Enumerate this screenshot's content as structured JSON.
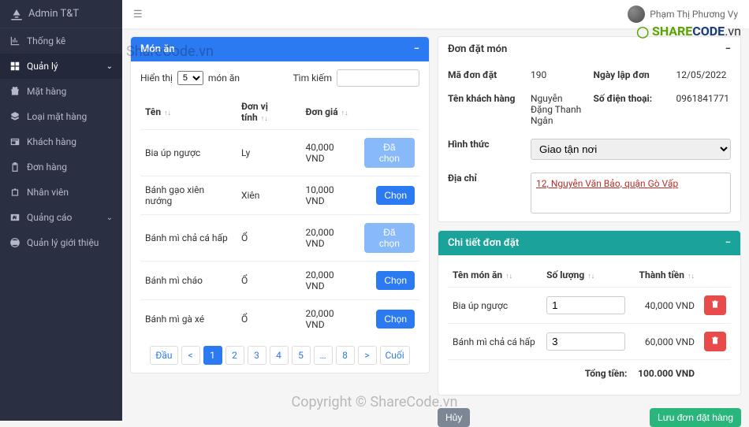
{
  "brand": "Admin T&T",
  "user_name": "Phạm Thị Phương Vy",
  "sidebar": {
    "items": [
      {
        "label": "Thống kê",
        "icon": "chart"
      },
      {
        "label": "Quản lý",
        "icon": "grid",
        "active": true,
        "expand": true
      },
      {
        "label": "Mặt hàng",
        "icon": "gift"
      },
      {
        "label": "Loại mặt hàng",
        "icon": "cubes"
      },
      {
        "label": "Khách hàng",
        "icon": "card"
      },
      {
        "label": "Đơn hàng",
        "icon": "clipboard"
      },
      {
        "label": "Nhân viên",
        "icon": "briefcase"
      },
      {
        "label": "Quảng cáo",
        "icon": "ad",
        "expand": true
      },
      {
        "label": "Quản lý giới thiệu",
        "icon": "globe"
      }
    ]
  },
  "food_panel": {
    "title": "Món ăn",
    "show_label_pre": "Hiển thị",
    "show_value": "5",
    "show_label_post": "món ăn",
    "search_label": "Tìm kiếm",
    "headers": {
      "name": "Tên",
      "unit": "Đơn vị tính",
      "price": "Đơn giá"
    },
    "rows": [
      {
        "name": "Bia úp ngược",
        "unit": "Ly",
        "price": "40,000 VND",
        "btn": "Đã chọn",
        "selected": true
      },
      {
        "name": "Bánh gạo xiên nướng",
        "unit": "Xiên",
        "price": "10,000 VND",
        "btn": "Chọn",
        "selected": false
      },
      {
        "name": "Bánh mì chả cá hấp",
        "unit": "Ổ",
        "price": "20,000 VND",
        "btn": "Đã chọn",
        "selected": true
      },
      {
        "name": "Bánh mì cháo",
        "unit": "Ổ",
        "price": "20,000 VND",
        "btn": "Chọn",
        "selected": false
      },
      {
        "name": "Bánh mì gà xé",
        "unit": "Ổ",
        "price": "20,000 VND",
        "btn": "Chọn",
        "selected": false
      }
    ],
    "pager": {
      "first": "Đầu",
      "prev": "<",
      "pages": [
        "1",
        "2",
        "3",
        "4",
        "5"
      ],
      "ellipsis": "…",
      "last_page": "8",
      "next": ">",
      "last": "Cuối",
      "active": "1"
    }
  },
  "order_panel": {
    "title": "Đơn đặt món",
    "fields": {
      "order_id_label": "Mã đơn đặt",
      "order_id": "190",
      "date_label": "Ngày lập đơn",
      "date": "12/05/2022",
      "cust_label": "Tên khách hàng",
      "cust": "Nguyễn Đặng Thanh Ngân",
      "phone_label": "Số điện thoại:",
      "phone": "0961841771",
      "method_label": "Hình thức",
      "method": "Giao tận nơi",
      "addr_label": "Địa chỉ",
      "addr": "12, Nguyễn Văn Bảo, quận Gò Vấp"
    }
  },
  "detail_panel": {
    "title": "Chi tiết đơn đặt",
    "headers": {
      "name": "Tên món ăn",
      "qty": "Số lượng",
      "amount": "Thành tiền"
    },
    "rows": [
      {
        "name": "Bia úp ngược",
        "qty": "1",
        "amount": "40,000 VND"
      },
      {
        "name": "Bánh mì chả cá hấp",
        "qty": "3",
        "amount": "60,000 VND"
      }
    ],
    "total_label": "Tổng tiền:",
    "total": "100.000 VND"
  },
  "buttons": {
    "cancel": "Hủy",
    "save": "Lưu đơn đặt hàng"
  },
  "watermarks": {
    "tl": "ShareCode.vn",
    "ctr": "Copyright © ShareCode.vn",
    "br1": "SHARE",
    "br2": "CODE",
    "br3": ".vn"
  }
}
